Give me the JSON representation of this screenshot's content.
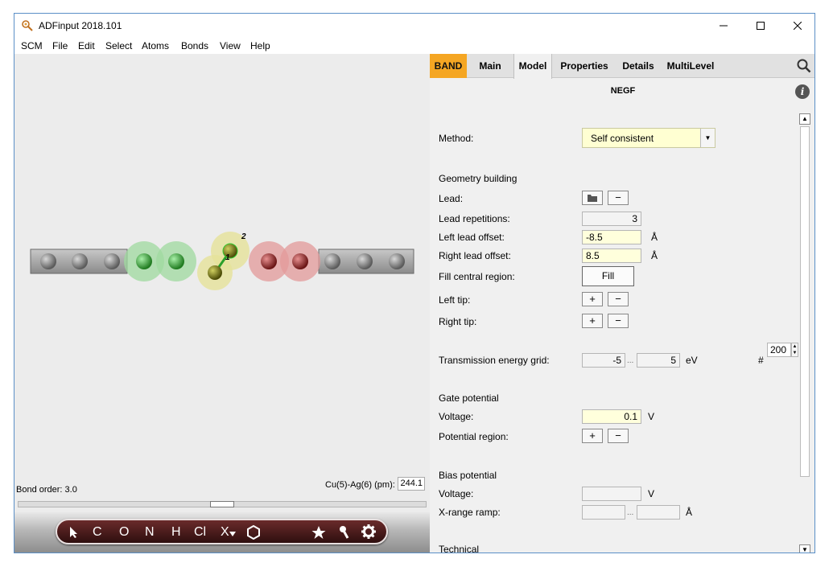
{
  "window": {
    "title": "ADFinput 2018.101"
  },
  "menu": [
    "SCM",
    "File",
    "Edit",
    "Select",
    "Atoms",
    "Bonds",
    "View",
    "Help"
  ],
  "viewer": {
    "atom_labels": [
      "2",
      "1"
    ],
    "bond_order": "Bond order: 3.0",
    "distance_label": "Cu(5)-Ag(6) (pm):",
    "distance_value": "244.1"
  },
  "toolbar": {
    "items": [
      "C",
      "O",
      "N",
      "H",
      "Cl",
      "X"
    ]
  },
  "tabs": [
    "BAND",
    "Main",
    "Model",
    "Properties",
    "Details",
    "MultiLevel"
  ],
  "active_tab": "Model",
  "panel": {
    "header": "NEGF",
    "method_label": "Method:",
    "method_value": "Self consistent",
    "geometry_heading": "Geometry building",
    "lead_label": "Lead:",
    "lead_repetitions_label": "Lead repetitions:",
    "lead_repetitions_value": "3",
    "left_offset_label": "Left lead offset:",
    "left_offset_value": "-8.5",
    "right_offset_label": "Right lead offset:",
    "right_offset_value": "8.5",
    "angstrom_unit": "Å",
    "fill_label": "Fill central region:",
    "fill_button": "Fill",
    "left_tip_label": "Left tip:",
    "right_tip_label": "Right tip:",
    "transmission_label": "Transmission energy grid:",
    "transmission_min": "-5",
    "transmission_max": "5",
    "range_sep": "...",
    "ev_unit": "eV",
    "hash": "#",
    "transmission_points": "200",
    "gate_heading": "Gate potential",
    "gate_voltage_label": "Voltage:",
    "gate_voltage_value": "0.1",
    "volt_unit": "V",
    "potential_region_label": "Potential region:",
    "bias_heading": "Bias potential",
    "bias_voltage_label": "Voltage:",
    "bias_voltage_value": "",
    "xrange_label": "X-range ramp:",
    "technical_heading": "Technical",
    "plus": "+",
    "minus": "−"
  },
  "colors": {
    "band_tab": "#f5a623",
    "input_yellow": "#ffffdc",
    "toolbar": "#4a1a1a",
    "lead_atoms": "#888888",
    "cu_atoms": "#55b055",
    "ag_atoms": "#b04a4a",
    "center_atoms": "#8a8a10"
  }
}
